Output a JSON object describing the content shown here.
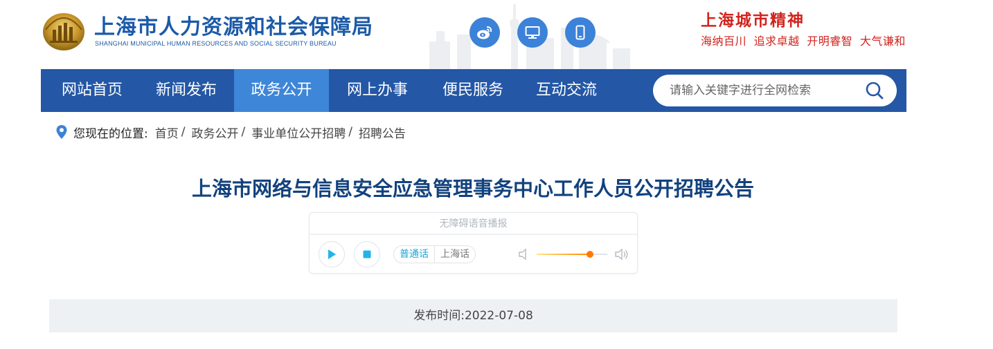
{
  "header": {
    "logo_cn": "上海市人力资源和社会保障局",
    "logo_en": "SHANGHAI MUNICIPAL HUMAN RESOURCES AND SOCIAL SECURITY BUREAU",
    "social_icons": [
      "weibo-icon",
      "desktop-icon",
      "mobile-icon"
    ],
    "motto_title": "上海城市精神",
    "motto_items": [
      "海纳百川",
      "追求卓越",
      "开明睿智",
      "大气谦和"
    ]
  },
  "nav": {
    "items": [
      {
        "label": "网站首页"
      },
      {
        "label": "新闻发布"
      },
      {
        "label": "政务公开",
        "active": true
      },
      {
        "label": "网上办事"
      },
      {
        "label": "便民服务"
      },
      {
        "label": "互动交流"
      }
    ],
    "search_placeholder": "请输入关键字进行全网检索"
  },
  "breadcrumb": {
    "label": "您现在的位置:",
    "items": [
      "首页",
      "政务公开",
      "事业单位公开招聘",
      "招聘公告"
    ]
  },
  "article": {
    "title": "上海市网络与信息安全应急管理事务中心工作人员公开招聘公告",
    "publish_label": "发布时间:2022-07-08"
  },
  "player": {
    "header": "无障碍语音播报",
    "lang_selected": "普通话",
    "lang_other": "上海话",
    "volume": 0.75
  },
  "colors": {
    "nav_bg": "#2457a5",
    "nav_active": "#3d86d8",
    "title": "#12427e",
    "motto": "#d2231d"
  }
}
